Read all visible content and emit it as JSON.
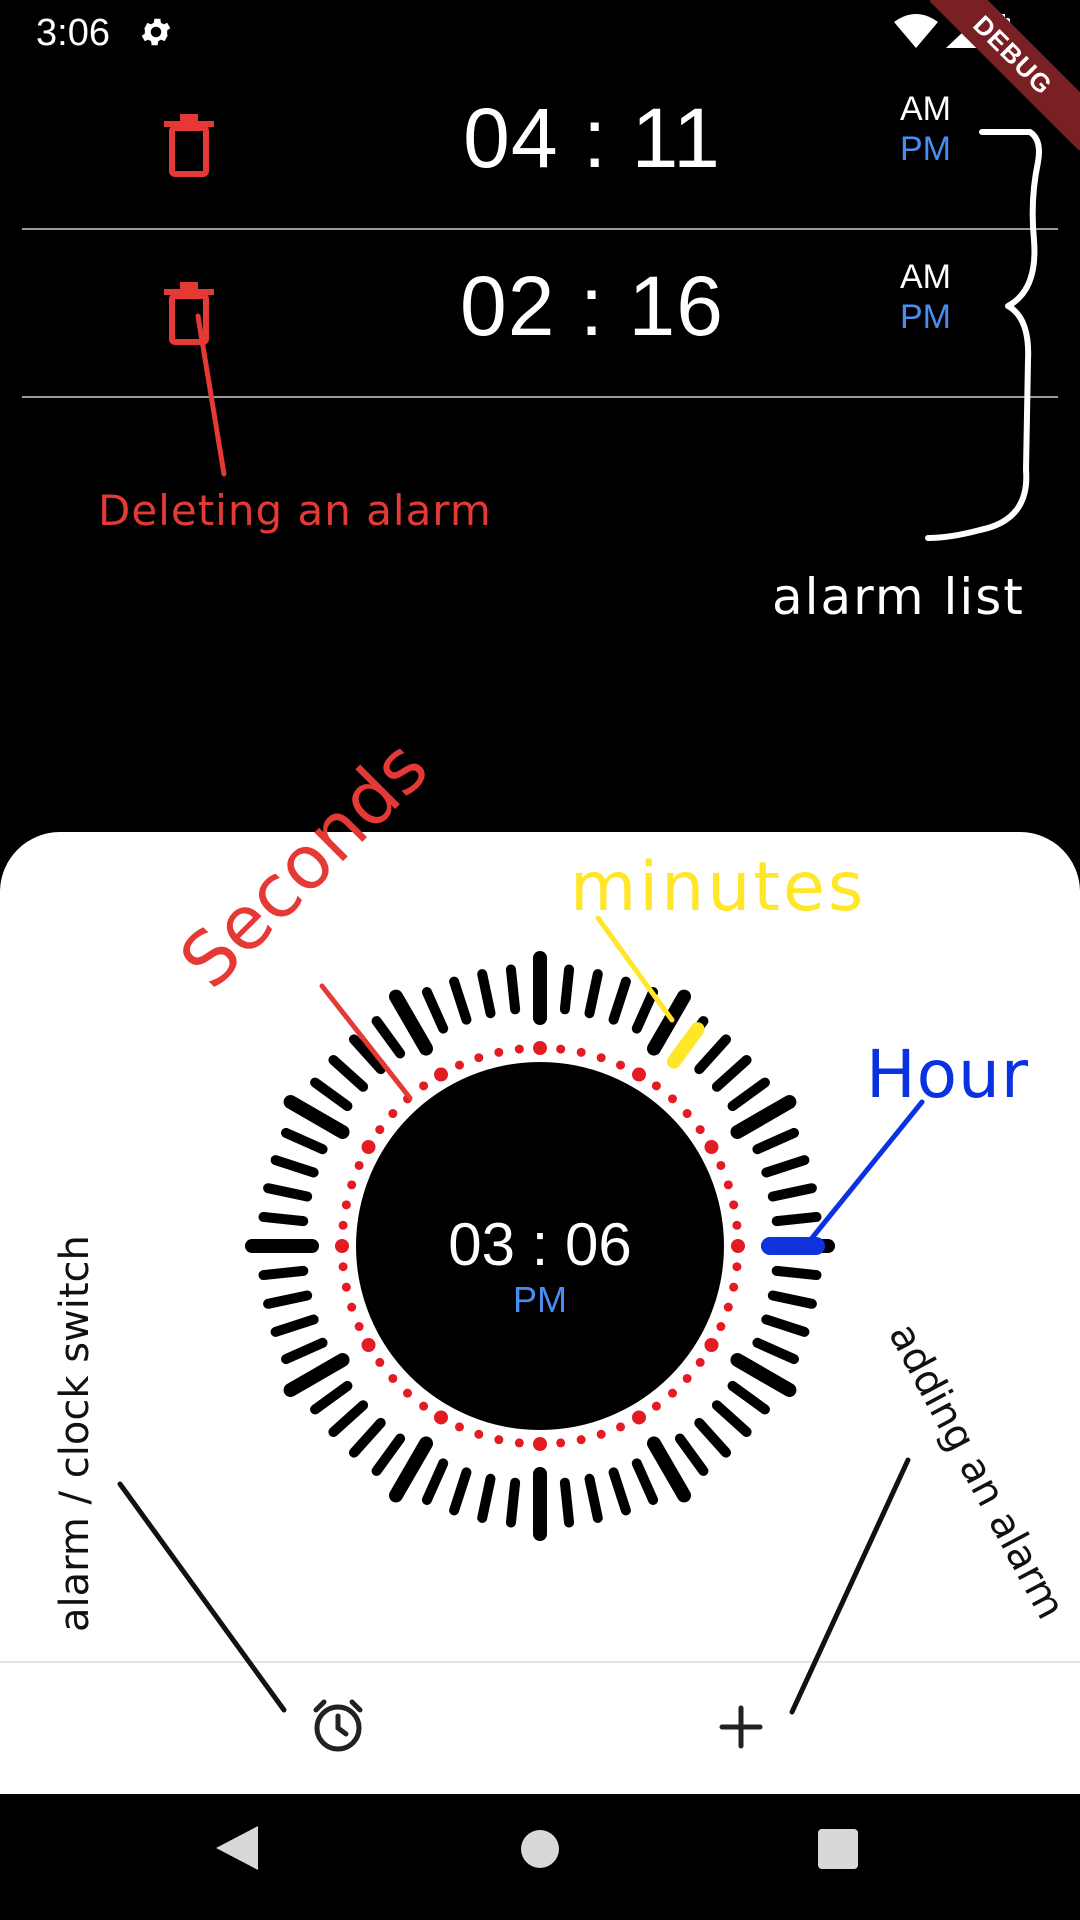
{
  "status_bar": {
    "time": "3:06",
    "debug_label": "DEBUG"
  },
  "alarms": [
    {
      "time": "04 : 11",
      "am": "AM",
      "pm": "PM"
    },
    {
      "time": "02 : 16",
      "am": "AM",
      "pm": "PM"
    }
  ],
  "clock": {
    "time": "03 : 06",
    "period": "PM"
  },
  "annotations": {
    "delete": "Deleting an alarm",
    "alarm_list": "alarm list",
    "seconds": "Seconds",
    "minutes": "minutes",
    "hour": "Hour",
    "switch": "alarm / clock switch",
    "add": "adding an alarm"
  },
  "colors": {
    "accent_blue": "#4a8df0",
    "delete_red": "#e53935",
    "annot_yellow": "#ffe629",
    "annot_blue": "#0a32e0"
  },
  "icons": {
    "delete": "trash-icon",
    "settings": "gear-icon",
    "switch": "alarm-clock-icon",
    "add": "plus-icon"
  }
}
